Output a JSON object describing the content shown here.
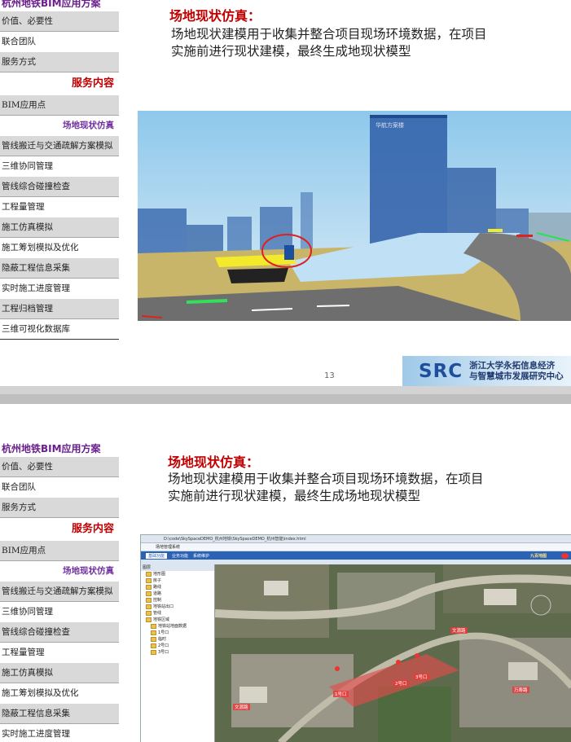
{
  "slide1": {
    "sidebar": {
      "header": "杭州地铁BIM应用方案",
      "items_top": [
        "价值、必要性",
        "联合团队",
        "服务方式"
      ],
      "section": "服务内容",
      "bim_point": "BIM应用点",
      "current": "场地现状仿真",
      "items_bottom": [
        "管线搬迁与交通疏解方案模拟",
        "三维协同管理",
        "管线综合碰撞检查",
        "工程量管理",
        "施工仿真模拟",
        "施工筹划模拟及优化",
        "隐蔽工程信息采集",
        "实时施工进度管理",
        "工程归档管理",
        "三维可视化数据库"
      ]
    },
    "title": "场地现状仿真：",
    "body": "场地现状建模用于收集并整合项目现场环境数据，在项目实施前进行现状建模，最终生成地现状模型",
    "image_label": "华航方案楼",
    "page_number": "13",
    "logo": {
      "brand": "SRC",
      "line1": "浙江大学永拓信息经济",
      "line2": "与智慧城市发展研究中心"
    }
  },
  "slide2": {
    "sidebar": {
      "header": "杭州地铁BIM应用方案",
      "items_top": [
        "价值、必要性",
        "联合团队",
        "服务方式"
      ],
      "section": "服务内容",
      "bim_point": "BIM应用点",
      "current": "场地现状仿真",
      "items_bottom": [
        "管线搬迁与交通疏解方案模拟",
        "三维协同管理",
        "管线综合碰撞检查",
        "工程量管理",
        "施工仿真模拟",
        "施工筹划模拟及优化",
        "隐蔽工程信息采集",
        "实时施工进度管理"
      ]
    },
    "title": "场地现状仿真：",
    "body": "场地现状建模用于收集并整合项目现场环境数据，在项目实施前进行现状建模，最终生成场地现状模型",
    "app": {
      "address": "D:\\code\\SkySpaceDEMO_杭州地铁\\SkySpaceDEMO_杭州智能\\index.html",
      "tab": "场地管理系统",
      "toolbar": [
        "基础功能",
        "业务功能",
        "系统维护"
      ],
      "panel_title": "图层",
      "layers": [
        "地形图",
        "房子",
        "路线",
        "道路",
        "控制",
        "地铁站出口",
        "管线",
        "地铁区域",
        "地铁站地面数据",
        "1号口",
        "临时",
        "2号口",
        "3号口"
      ],
      "brand": "九百地图",
      "map_labels": [
        "文源路",
        "万寿路",
        "文源路",
        "1号口",
        "2号口",
        "3号口"
      ]
    }
  },
  "colors": {
    "title_red": "#c00000",
    "header_purple": "#6a1e8c",
    "sub_purple": "#7030a0",
    "sidebar_gray": "#d9d9d9"
  }
}
